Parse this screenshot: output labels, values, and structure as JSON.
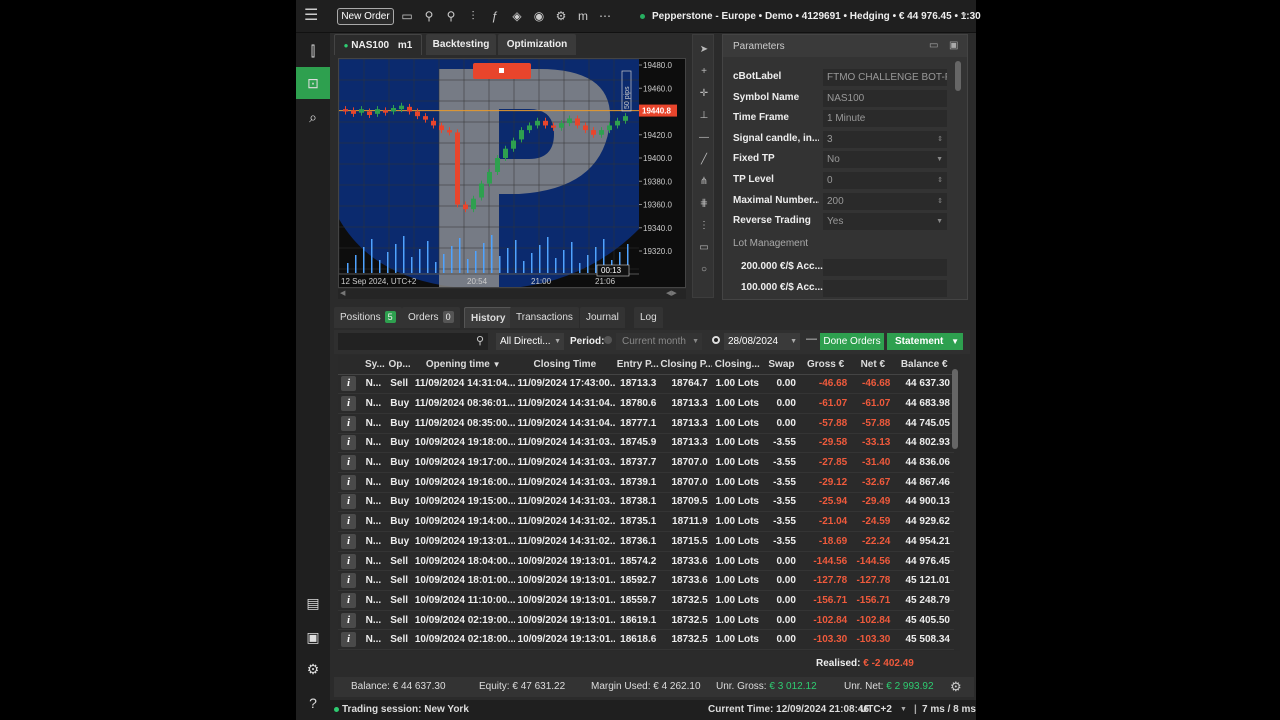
{
  "topbar": {
    "new_order": "New Order",
    "account": "Pepperstone - Europe • Demo • 4129691 • Hedging • € 44 976.45 • 1:30"
  },
  "chart": {
    "tabs": [
      "NAS100",
      "m1",
      "Backtesting",
      "Optimization"
    ],
    "symbol_label": "NAS100",
    "timeframe": "m1",
    "price_ticks": [
      "19480.0",
      "19460.0",
      "19440.8",
      "19420.0",
      "19400.0",
      "19380.0",
      "19360.0",
      "19340.0",
      "19320.0"
    ],
    "current_price": "19440.8",
    "pips_label": "50 pips",
    "time_labels": [
      "12 Sep 2024, UTC+2",
      "20:54",
      "21:00",
      "21:06"
    ],
    "countdown": "00:13"
  },
  "parameters": {
    "title": "Parameters",
    "rows": [
      {
        "label": "cBotLabel",
        "value": "FTMO CHALLENGE BOT-F"
      },
      {
        "label": "Symbol Name",
        "value": "NAS100"
      },
      {
        "label": "Time Frame",
        "value": "1 Minute"
      },
      {
        "label": "Signal candle, in...",
        "value": "3"
      },
      {
        "label": "Fixed TP",
        "value": "No"
      },
      {
        "label": "TP Level",
        "value": "0"
      },
      {
        "label": "Maximal Number...",
        "value": "200"
      },
      {
        "label": "Reverse Trading",
        "value": "Yes"
      }
    ],
    "section": "Lot Management",
    "lot_rows": [
      "200.000 €/$ Acc...",
      "100.000 €/$ Acc..."
    ]
  },
  "bottom": {
    "tabs": {
      "positions": "Positions",
      "positions_count": "5",
      "orders": "Orders",
      "orders_count": "0",
      "history": "History",
      "transactions": "Transactions",
      "journal": "Journal",
      "log": "Log"
    },
    "filters": {
      "direction": "All Directi...",
      "period_label": "Period:",
      "period_value": "Current month",
      "date": "28/08/2024",
      "done_orders": "Done Orders",
      "statement": "Statement"
    },
    "columns": [
      "Sy...",
      "Op...",
      "Opening time",
      "Closing Time",
      "Entry P...",
      "Closing P...",
      "Closing...",
      "Swap",
      "Gross €",
      "Net €",
      "Balance €"
    ],
    "rows": [
      [
        "N...",
        "Sell",
        "11/09/2024 14:31:04...",
        "11/09/2024 17:43:00...",
        "18713.3",
        "18764.7",
        "1.00 Lots",
        "0.00",
        "-46.68",
        "-46.68",
        "44 637.30"
      ],
      [
        "N...",
        "Buy",
        "11/09/2024 08:36:01...",
        "11/09/2024 14:31:04...",
        "18780.6",
        "18713.3",
        "1.00 Lots",
        "0.00",
        "-61.07",
        "-61.07",
        "44 683.98"
      ],
      [
        "N...",
        "Buy",
        "11/09/2024 08:35:00...",
        "11/09/2024 14:31:04...",
        "18777.1",
        "18713.3",
        "1.00 Lots",
        "0.00",
        "-57.88",
        "-57.88",
        "44 745.05"
      ],
      [
        "N...",
        "Buy",
        "10/09/2024 19:18:00...",
        "11/09/2024 14:31:03...",
        "18745.9",
        "18713.3",
        "1.00 Lots",
        "-3.55",
        "-29.58",
        "-33.13",
        "44 802.93"
      ],
      [
        "N...",
        "Buy",
        "10/09/2024 19:17:00...",
        "11/09/2024 14:31:03...",
        "18737.7",
        "18707.0",
        "1.00 Lots",
        "-3.55",
        "-27.85",
        "-31.40",
        "44 836.06"
      ],
      [
        "N...",
        "Buy",
        "10/09/2024 19:16:00...",
        "11/09/2024 14:31:03...",
        "18739.1",
        "18707.0",
        "1.00 Lots",
        "-3.55",
        "-29.12",
        "-32.67",
        "44 867.46"
      ],
      [
        "N...",
        "Buy",
        "10/09/2024 19:15:00...",
        "11/09/2024 14:31:03...",
        "18738.1",
        "18709.5",
        "1.00 Lots",
        "-3.55",
        "-25.94",
        "-29.49",
        "44 900.13"
      ],
      [
        "N...",
        "Buy",
        "10/09/2024 19:14:00...",
        "11/09/2024 14:31:02...",
        "18735.1",
        "18711.9",
        "1.00 Lots",
        "-3.55",
        "-21.04",
        "-24.59",
        "44 929.62"
      ],
      [
        "N...",
        "Buy",
        "10/09/2024 19:13:01...",
        "11/09/2024 14:31:02...",
        "18736.1",
        "18715.5",
        "1.00 Lots",
        "-3.55",
        "-18.69",
        "-22.24",
        "44 954.21"
      ],
      [
        "N...",
        "Sell",
        "10/09/2024 18:04:00...",
        "10/09/2024 19:13:01...",
        "18574.2",
        "18733.6",
        "1.00 Lots",
        "0.00",
        "-144.56",
        "-144.56",
        "44 976.45"
      ],
      [
        "N...",
        "Sell",
        "10/09/2024 18:01:00...",
        "10/09/2024 19:13:01...",
        "18592.7",
        "18733.6",
        "1.00 Lots",
        "0.00",
        "-127.78",
        "-127.78",
        "45 121.01"
      ],
      [
        "N...",
        "Sell",
        "10/09/2024 11:10:00...",
        "10/09/2024 19:13:01...",
        "18559.7",
        "18732.5",
        "1.00 Lots",
        "0.00",
        "-156.71",
        "-156.71",
        "45 248.79"
      ],
      [
        "N...",
        "Sell",
        "10/09/2024 02:19:00...",
        "10/09/2024 19:13:01...",
        "18619.1",
        "18732.5",
        "1.00 Lots",
        "0.00",
        "-102.84",
        "-102.84",
        "45 405.50"
      ],
      [
        "N...",
        "Sell",
        "10/09/2024 02:18:00...",
        "10/09/2024 19:13:01...",
        "18618.6",
        "18732.5",
        "1.00 Lots",
        "0.00",
        "-103.30",
        "-103.30",
        "45 508.34"
      ]
    ],
    "realised_label": "Realised:",
    "realised_value": "€ -2 402.49"
  },
  "status": {
    "balance": "Balance: € 44 637.30",
    "equity": "Equity: € 47 631.22",
    "margin": "Margin Used: € 4 262.10",
    "unr_gross_label": "Unr. Gross:",
    "unr_gross_value": "€ 3 012.12",
    "unr_net_label": "Unr. Net:",
    "unr_net_value": "€ 2 993.92"
  },
  "footer": {
    "session": "Trading session: New York",
    "current_time": "Current Time: 12/09/2024 21:08:46",
    "tz": "UTC+2",
    "latency": "7 ms / 8 ms"
  },
  "colors": {
    "accent": "#2ea04f",
    "negative": "#ef5a3c",
    "positive": "#2ecc71",
    "chart_bg_blue": "#0b2a6e"
  }
}
